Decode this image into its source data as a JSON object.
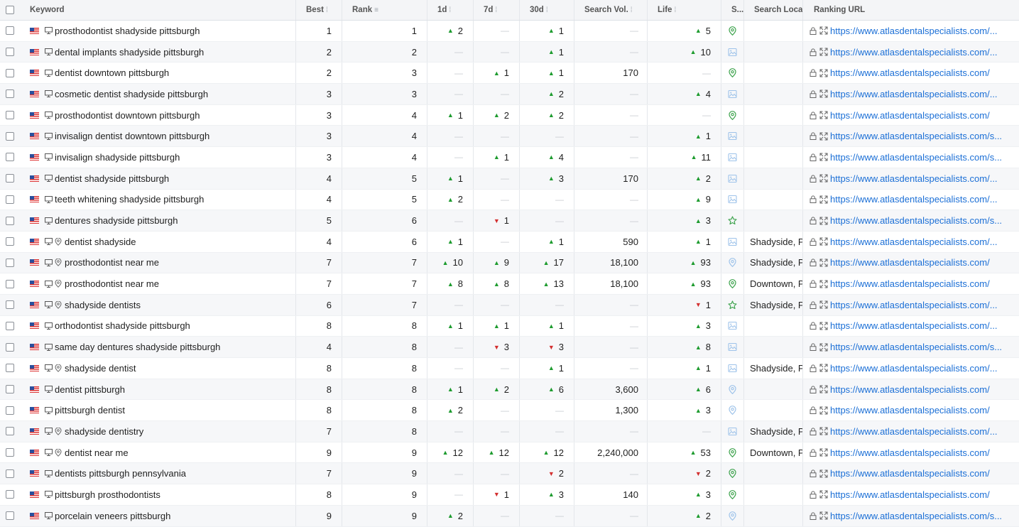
{
  "header": {
    "keyword": "Keyword",
    "best": "Best",
    "rank": "Rank",
    "d1": "1d",
    "d7": "7d",
    "d30": "30d",
    "search_vol": "Search Vol.",
    "life": "Life",
    "serp": "S...",
    "search_location": "Search Locati",
    "ranking_url": "Ranking URL"
  },
  "colors": {
    "up": "#1d9b2e",
    "down": "#d32f2f",
    "link": "#1b6fd6",
    "serp_green": "#3aa14a",
    "serp_blue": "#9ec3ea"
  },
  "rows": [
    {
      "keyword": "prosthodontist shadyside pittsburgh",
      "pin": false,
      "best": "1",
      "rank": "1",
      "d1": {
        "dir": "up",
        "val": "2"
      },
      "d7": null,
      "d30": {
        "dir": "up",
        "val": "1"
      },
      "vol": "—",
      "life": {
        "dir": "up",
        "val": "5"
      },
      "serp": "map-pin-icon",
      "loc": "",
      "url": "https://www.atlasdentalspecialists.com/..."
    },
    {
      "keyword": "dental implants shadyside pittsburgh",
      "pin": false,
      "best": "2",
      "rank": "2",
      "d1": null,
      "d7": null,
      "d30": {
        "dir": "up",
        "val": "1"
      },
      "vol": "—",
      "life": {
        "dir": "up",
        "val": "10"
      },
      "serp": "image-icon",
      "loc": "",
      "url": "https://www.atlasdentalspecialists.com/..."
    },
    {
      "keyword": "dentist downtown pittsburgh",
      "pin": false,
      "best": "2",
      "rank": "3",
      "d1": null,
      "d7": {
        "dir": "up",
        "val": "1"
      },
      "d30": {
        "dir": "up",
        "val": "1"
      },
      "vol": "170",
      "life": null,
      "serp": "map-pin-icon",
      "loc": "",
      "url": "https://www.atlasdentalspecialists.com/"
    },
    {
      "keyword": "cosmetic dentist shadyside pittsburgh",
      "pin": false,
      "best": "3",
      "rank": "3",
      "d1": null,
      "d7": null,
      "d30": {
        "dir": "up",
        "val": "2"
      },
      "vol": "—",
      "life": {
        "dir": "up",
        "val": "4"
      },
      "serp": "image-icon",
      "loc": "",
      "url": "https://www.atlasdentalspecialists.com/..."
    },
    {
      "keyword": "prosthodontist downtown pittsburgh",
      "pin": false,
      "best": "3",
      "rank": "4",
      "d1": {
        "dir": "up",
        "val": "1"
      },
      "d7": {
        "dir": "up",
        "val": "2"
      },
      "d30": {
        "dir": "up",
        "val": "2"
      },
      "vol": "—",
      "life": null,
      "serp": "map-pin-icon",
      "loc": "",
      "url": "https://www.atlasdentalspecialists.com/"
    },
    {
      "keyword": "invisalign dentist downtown pittsburgh",
      "pin": false,
      "best": "3",
      "rank": "4",
      "d1": null,
      "d7": null,
      "d30": null,
      "vol": "—",
      "life": {
        "dir": "up",
        "val": "1"
      },
      "serp": "image-icon",
      "loc": "",
      "url": "https://www.atlasdentalspecialists.com/s..."
    },
    {
      "keyword": "invisalign shadyside pittsburgh",
      "pin": false,
      "best": "3",
      "rank": "4",
      "d1": null,
      "d7": {
        "dir": "up",
        "val": "1"
      },
      "d30": {
        "dir": "up",
        "val": "4"
      },
      "vol": "—",
      "life": {
        "dir": "up",
        "val": "11"
      },
      "serp": "image-icon",
      "loc": "",
      "url": "https://www.atlasdentalspecialists.com/s..."
    },
    {
      "keyword": "dentist shadyside pittsburgh",
      "pin": false,
      "best": "4",
      "rank": "5",
      "d1": {
        "dir": "up",
        "val": "1"
      },
      "d7": null,
      "d30": {
        "dir": "up",
        "val": "3"
      },
      "vol": "170",
      "life": {
        "dir": "up",
        "val": "2"
      },
      "serp": "image-icon",
      "loc": "",
      "url": "https://www.atlasdentalspecialists.com/..."
    },
    {
      "keyword": "teeth whitening shadyside pittsburgh",
      "pin": false,
      "best": "4",
      "rank": "5",
      "d1": {
        "dir": "up",
        "val": "2"
      },
      "d7": null,
      "d30": null,
      "vol": "—",
      "life": {
        "dir": "up",
        "val": "9"
      },
      "serp": "image-icon",
      "loc": "",
      "url": "https://www.atlasdentalspecialists.com/..."
    },
    {
      "keyword": "dentures shadyside pittsburgh",
      "pin": false,
      "best": "5",
      "rank": "6",
      "d1": null,
      "d7": {
        "dir": "down",
        "val": "1"
      },
      "d30": null,
      "vol": "—",
      "life": {
        "dir": "up",
        "val": "3"
      },
      "serp": "star-icon",
      "loc": "",
      "url": "https://www.atlasdentalspecialists.com/s..."
    },
    {
      "keyword": "dentist shadyside",
      "pin": true,
      "best": "4",
      "rank": "6",
      "d1": {
        "dir": "up",
        "val": "1"
      },
      "d7": null,
      "d30": {
        "dir": "up",
        "val": "1"
      },
      "vol": "590",
      "life": {
        "dir": "up",
        "val": "1"
      },
      "serp": "image-icon",
      "loc": "Shadyside, Pit",
      "url": "https://www.atlasdentalspecialists.com/..."
    },
    {
      "keyword": "prosthodontist near me",
      "pin": true,
      "best": "7",
      "rank": "7",
      "d1": {
        "dir": "up",
        "val": "10"
      },
      "d7": {
        "dir": "up",
        "val": "9"
      },
      "d30": {
        "dir": "up",
        "val": "17"
      },
      "vol": "18,100",
      "life": {
        "dir": "up",
        "val": "93"
      },
      "serp": "map-pin-light-icon",
      "loc": "Shadyside, Pit",
      "url": "https://www.atlasdentalspecialists.com/"
    },
    {
      "keyword": "prosthodontist near me",
      "pin": true,
      "best": "7",
      "rank": "7",
      "d1": {
        "dir": "up",
        "val": "8"
      },
      "d7": {
        "dir": "up",
        "val": "8"
      },
      "d30": {
        "dir": "up",
        "val": "13"
      },
      "vol": "18,100",
      "life": {
        "dir": "up",
        "val": "93"
      },
      "serp": "map-pin-icon",
      "loc": "Downtown, P",
      "url": "https://www.atlasdentalspecialists.com/"
    },
    {
      "keyword": "shadyside dentists",
      "pin": true,
      "best": "6",
      "rank": "7",
      "d1": null,
      "d7": null,
      "d30": null,
      "vol": "—",
      "life": {
        "dir": "down",
        "val": "1"
      },
      "serp": "star-icon",
      "loc": "Shadyside, Pit",
      "url": "https://www.atlasdentalspecialists.com/..."
    },
    {
      "keyword": "orthodontist shadyside pittsburgh",
      "pin": false,
      "best": "8",
      "rank": "8",
      "d1": {
        "dir": "up",
        "val": "1"
      },
      "d7": {
        "dir": "up",
        "val": "1"
      },
      "d30": {
        "dir": "up",
        "val": "1"
      },
      "vol": "—",
      "life": {
        "dir": "up",
        "val": "3"
      },
      "serp": "image-icon",
      "loc": "",
      "url": "https://www.atlasdentalspecialists.com/..."
    },
    {
      "keyword": "same day dentures shadyside pittsburgh",
      "pin": false,
      "best": "4",
      "rank": "8",
      "d1": null,
      "d7": {
        "dir": "down",
        "val": "3"
      },
      "d30": {
        "dir": "down",
        "val": "3"
      },
      "vol": "—",
      "life": {
        "dir": "up",
        "val": "8"
      },
      "serp": "image-icon",
      "loc": "",
      "url": "https://www.atlasdentalspecialists.com/s..."
    },
    {
      "keyword": "shadyside dentist",
      "pin": true,
      "best": "8",
      "rank": "8",
      "d1": null,
      "d7": null,
      "d30": {
        "dir": "up",
        "val": "1"
      },
      "vol": "—",
      "life": {
        "dir": "up",
        "val": "1"
      },
      "serp": "image-icon",
      "loc": "Shadyside, Pit",
      "url": "https://www.atlasdentalspecialists.com/..."
    },
    {
      "keyword": "dentist pittsburgh",
      "pin": false,
      "best": "8",
      "rank": "8",
      "d1": {
        "dir": "up",
        "val": "1"
      },
      "d7": {
        "dir": "up",
        "val": "2"
      },
      "d30": {
        "dir": "up",
        "val": "6"
      },
      "vol": "3,600",
      "life": {
        "dir": "up",
        "val": "6"
      },
      "serp": "map-pin-light-icon",
      "loc": "",
      "url": "https://www.atlasdentalspecialists.com/"
    },
    {
      "keyword": "pittsburgh dentist",
      "pin": false,
      "best": "8",
      "rank": "8",
      "d1": {
        "dir": "up",
        "val": "2"
      },
      "d7": null,
      "d30": null,
      "vol": "1,300",
      "life": {
        "dir": "up",
        "val": "3"
      },
      "serp": "map-pin-light-icon",
      "loc": "",
      "url": "https://www.atlasdentalspecialists.com/"
    },
    {
      "keyword": "shadyside dentistry",
      "pin": true,
      "best": "7",
      "rank": "8",
      "d1": null,
      "d7": null,
      "d30": null,
      "vol": "—",
      "life": null,
      "serp": "image-icon",
      "loc": "Shadyside, Pit",
      "url": "https://www.atlasdentalspecialists.com/..."
    },
    {
      "keyword": "dentist near me",
      "pin": true,
      "best": "9",
      "rank": "9",
      "d1": {
        "dir": "up",
        "val": "12"
      },
      "d7": {
        "dir": "up",
        "val": "12"
      },
      "d30": {
        "dir": "up",
        "val": "12"
      },
      "vol": "2,240,000",
      "life": {
        "dir": "up",
        "val": "53"
      },
      "serp": "map-pin-icon",
      "loc": "Downtown, P",
      "url": "https://www.atlasdentalspecialists.com/"
    },
    {
      "keyword": "dentists pittsburgh pennsylvania",
      "pin": false,
      "best": "7",
      "rank": "9",
      "d1": null,
      "d7": null,
      "d30": {
        "dir": "down",
        "val": "2"
      },
      "vol": "—",
      "life": {
        "dir": "down",
        "val": "2"
      },
      "serp": "map-pin-icon",
      "loc": "",
      "url": "https://www.atlasdentalspecialists.com/"
    },
    {
      "keyword": "pittsburgh prosthodontists",
      "pin": false,
      "best": "8",
      "rank": "9",
      "d1": null,
      "d7": {
        "dir": "down",
        "val": "1"
      },
      "d30": {
        "dir": "up",
        "val": "3"
      },
      "vol": "140",
      "life": {
        "dir": "up",
        "val": "3"
      },
      "serp": "map-pin-icon",
      "loc": "",
      "url": "https://www.atlasdentalspecialists.com/"
    },
    {
      "keyword": "porcelain veneers pittsburgh",
      "pin": false,
      "best": "9",
      "rank": "9",
      "d1": {
        "dir": "up",
        "val": "2"
      },
      "d7": null,
      "d30": null,
      "vol": "—",
      "life": {
        "dir": "up",
        "val": "2"
      },
      "serp": "map-pin-light-icon",
      "loc": "",
      "url": "https://www.atlasdentalspecialists.com/s..."
    }
  ]
}
